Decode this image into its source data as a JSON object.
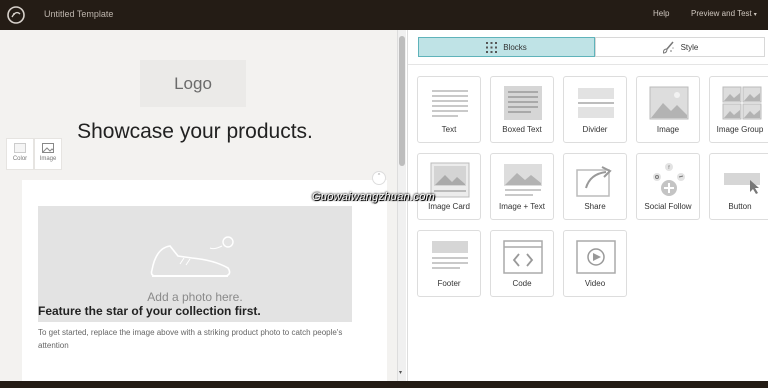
{
  "header": {
    "template_title": "Untitled Template",
    "help_label": "Help",
    "preview_label": "Preview and Test",
    "preview_caret": "▾"
  },
  "editor": {
    "logo_placeholder": "Logo",
    "headline": "Showcase your products.",
    "tool_color_label": "Color",
    "tool_image_label": "Image",
    "collapse_glyph": "ˆ",
    "photo_placeholder": "Add a photo here.",
    "feature_title": "Feature the star of your collection first.",
    "feature_body": "To get started, replace the image above with a striking product photo to catch people's attention"
  },
  "panel": {
    "tabs": [
      {
        "label": "Blocks",
        "active": true,
        "icon": "grid-icon"
      },
      {
        "label": "Style",
        "active": false,
        "icon": "paintbrush-icon"
      }
    ],
    "blocks": [
      {
        "label": "Text",
        "icon": "text-block-icon"
      },
      {
        "label": "Boxed Text",
        "icon": "boxed-text-icon"
      },
      {
        "label": "Divider",
        "icon": "divider-icon"
      },
      {
        "label": "Image",
        "icon": "image-icon"
      },
      {
        "label": "Image Group",
        "icon": "image-group-icon"
      },
      {
        "label": "Image Card",
        "icon": "image-card-icon"
      },
      {
        "label": "Image + Text",
        "icon": "image-text-icon"
      },
      {
        "label": "Share",
        "icon": "share-icon"
      },
      {
        "label": "Social Follow",
        "icon": "social-follow-icon"
      },
      {
        "label": "Button",
        "icon": "button-icon"
      },
      {
        "label": "Footer",
        "icon": "footer-icon"
      },
      {
        "label": "Code",
        "icon": "code-icon"
      },
      {
        "label": "Video",
        "icon": "video-icon"
      }
    ]
  },
  "scrollbar": {
    "down_glyph": "▾"
  },
  "watermark": "Guowaiwangzhuan.com",
  "colors": {
    "topbar": "#241c15",
    "active_tab": "#bfe3e6",
    "active_tab_border": "#5fb3ba",
    "canvas": "#f3f2f0"
  }
}
